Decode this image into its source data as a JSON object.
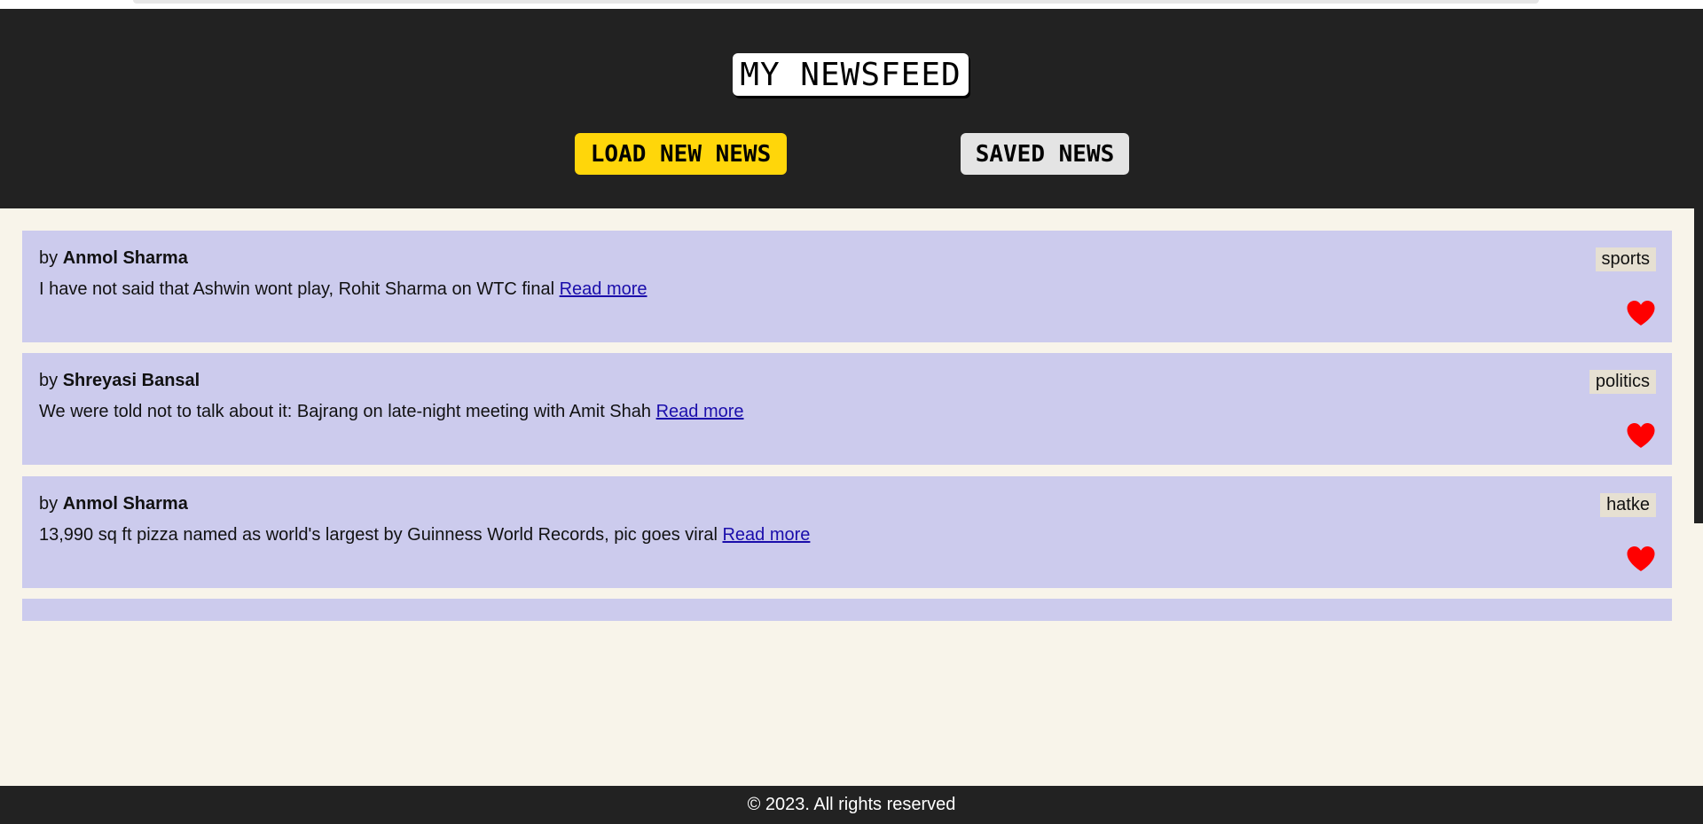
{
  "header": {
    "title": "MY NEWSFEED",
    "load_button": "LOAD NEW NEWS",
    "saved_button": "SAVED NEWS"
  },
  "colors": {
    "header_bg": "#222222",
    "page_bg": "#f8f4ea",
    "card_bg": "#cccbed",
    "load_button_bg": "#ffd60a",
    "saved_button_bg": "#e4e4e4",
    "heart": "#ff0000",
    "link": "#1a0dab"
  },
  "news": [
    {
      "by_prefix": "by",
      "author": "Anmol Sharma",
      "headline": "I have not said that Ashwin wont play, Rohit Sharma on WTC final",
      "read_more": "Read more",
      "category": "sports",
      "icon": "heart-icon"
    },
    {
      "by_prefix": "by",
      "author": "Shreyasi Bansal",
      "headline": "We were told not to talk about it: Bajrang on late-night meeting with Amit Shah",
      "read_more": "Read more",
      "category": "politics",
      "icon": "heart-icon"
    },
    {
      "by_prefix": "by",
      "author": "Anmol Sharma",
      "headline": "13,990 sq ft pizza named as world's largest by Guinness World Records, pic goes viral",
      "read_more": "Read more",
      "category": "hatke",
      "icon": "heart-icon"
    }
  ],
  "footer": {
    "text": "© 2023. All rights reserved"
  }
}
